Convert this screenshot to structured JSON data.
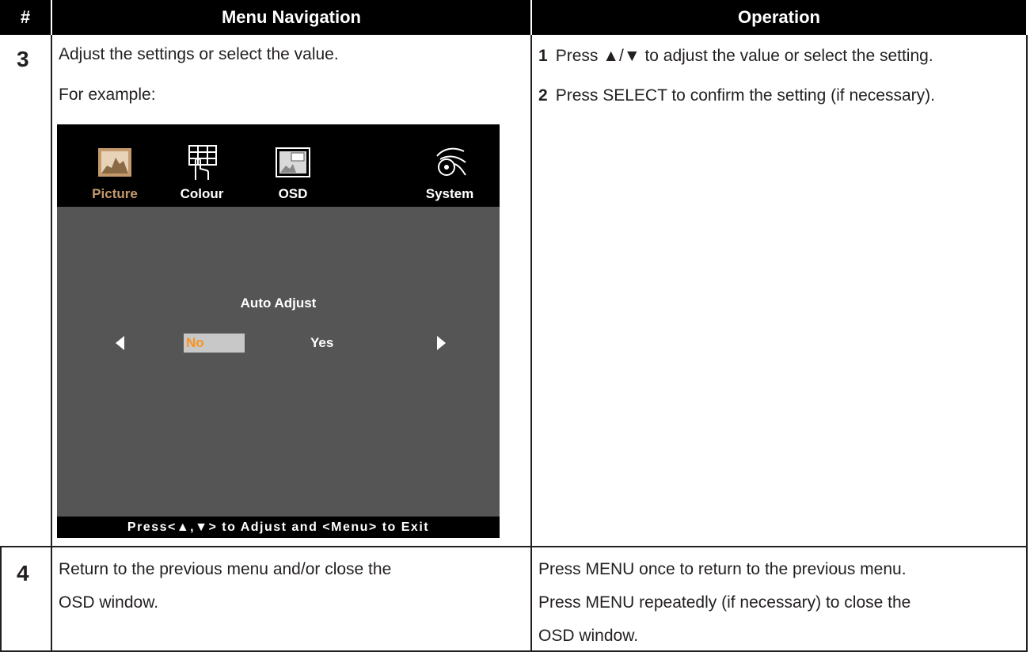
{
  "header": {
    "num": "#",
    "navigation": "Menu Navigation",
    "operation": "Operation"
  },
  "step3": {
    "number": "3",
    "nav_line1": "Adjust the settings or select the value.",
    "nav_line2": "For example:",
    "ops": [
      {
        "n": "1",
        "text": "Press ▲/▼ to adjust the value or select the setting."
      },
      {
        "n": "2",
        "text": "Press SELECT to confirm the setting (if necessary)."
      }
    ]
  },
  "osd": {
    "tabs": [
      {
        "label": "Picture",
        "icon": "picture-icon",
        "active": true
      },
      {
        "label": "Colour",
        "icon": "colour-icon",
        "active": false
      },
      {
        "label": "OSD",
        "icon": "osd-icon",
        "active": false
      },
      {
        "label": "System",
        "icon": "system-icon",
        "active": false
      }
    ],
    "title": "Auto Adjust",
    "option_no": "No",
    "option_yes": "Yes",
    "footer": "Press<▲,▼> to Adjust and <Menu> to Exit",
    "colors": {
      "active_tab": "#c49a6c",
      "selected_option": "#f7941d",
      "body": "#555556"
    }
  },
  "step4": {
    "number": "4",
    "nav_line1": "Return to the previous menu and/or close the",
    "nav_line2": "OSD window.",
    "op_line1": "Press MENU once to return to the previous menu.",
    "op_line2": "Press MENU repeatedly (if necessary) to close the",
    "op_line3": "OSD window."
  }
}
